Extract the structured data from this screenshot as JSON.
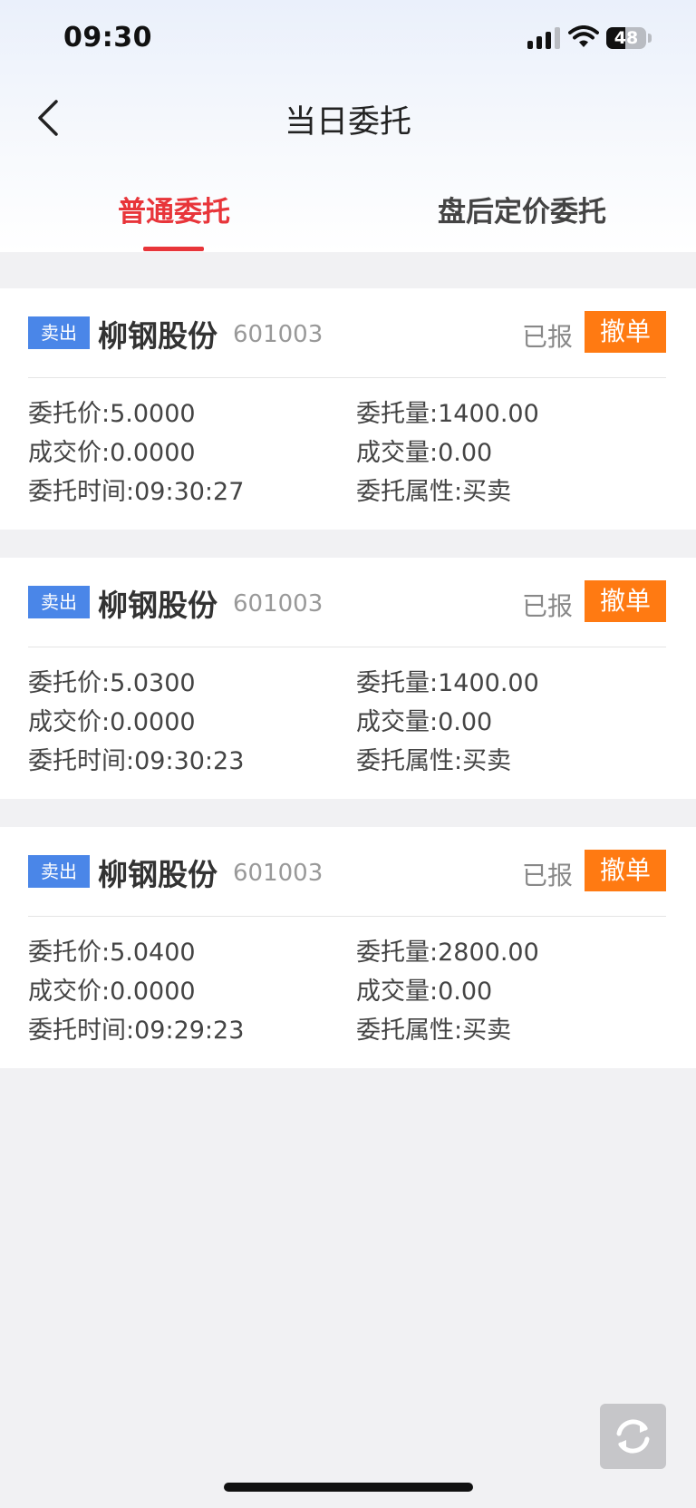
{
  "status_bar": {
    "time": "09:30",
    "battery": "48",
    "battery_level": 0.48
  },
  "nav": {
    "title": "当日委托"
  },
  "tabs": [
    {
      "label": "普通委托",
      "active": true
    },
    {
      "label": "盘后定价委托",
      "active": false
    }
  ],
  "field_labels": {
    "price": "委托价:",
    "deal_price": "成交价:",
    "time": "委托时间:",
    "qty": "委托量:",
    "deal_qty": "成交量:",
    "attr": "委托属性:"
  },
  "orders": [
    {
      "side": "卖出",
      "name": "柳钢股份",
      "code": "601003",
      "status": "已报",
      "action": "撤单",
      "price": "5.0000",
      "deal_price": "0.0000",
      "time": "09:30:27",
      "qty": "1400.00",
      "deal_qty": "0.00",
      "attr": "买卖"
    },
    {
      "side": "卖出",
      "name": "柳钢股份",
      "code": "601003",
      "status": "已报",
      "action": "撤单",
      "price": "5.0300",
      "deal_price": "0.0000",
      "time": "09:30:23",
      "qty": "1400.00",
      "deal_qty": "0.00",
      "attr": "买卖"
    },
    {
      "side": "卖出",
      "name": "柳钢股份",
      "code": "601003",
      "status": "已报",
      "action": "撤单",
      "price": "5.0400",
      "deal_price": "0.0000",
      "time": "09:29:23",
      "qty": "2800.00",
      "deal_qty": "0.00",
      "attr": "买卖"
    }
  ],
  "colors": {
    "accent_red": "#e8353a",
    "sell_badge": "#4a86e8",
    "cancel_button": "#ff7a12",
    "page_bg": "#f1f1f3"
  },
  "icons": {
    "back": "chevron-left-icon",
    "refresh": "refresh-icon",
    "signal": "signal-icon",
    "wifi": "wifi-icon"
  }
}
